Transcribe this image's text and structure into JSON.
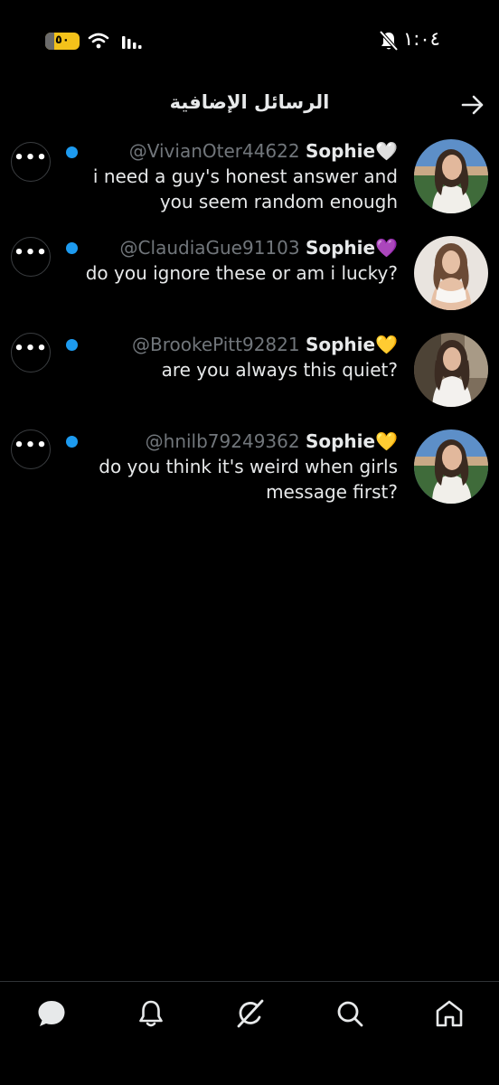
{
  "status_bar": {
    "battery_percent": "٥٠",
    "time": "١:٠٤",
    "battery_color": "#f4c21a"
  },
  "header": {
    "title": "الرسائل الإضافية"
  },
  "messages": [
    {
      "handle": "@VivianOter44622",
      "name": "Sophie",
      "emoji": "🤍",
      "text": "i need a guy's honest answer and you seem random enough"
    },
    {
      "handle": "@ClaudiaGue91103",
      "name": "Sophie",
      "emoji": "💜",
      "text": "do you ignore these or am i lucky?"
    },
    {
      "handle": "@BrookePitt92821",
      "name": "Sophie",
      "emoji": "💛",
      "text": "are you always this quiet?"
    },
    {
      "handle": "@hnilb79249362",
      "name": "Sophie",
      "emoji": "💛",
      "text": "do you think it's weird when girls message first?"
    }
  ],
  "more_label": "•••",
  "bottom_nav": [
    "messages-icon",
    "notifications-icon",
    "grok-icon",
    "search-icon",
    "home-icon"
  ],
  "colors": {
    "accent": "#1d9bf0",
    "background": "#000000",
    "muted_text": "#71767b"
  }
}
